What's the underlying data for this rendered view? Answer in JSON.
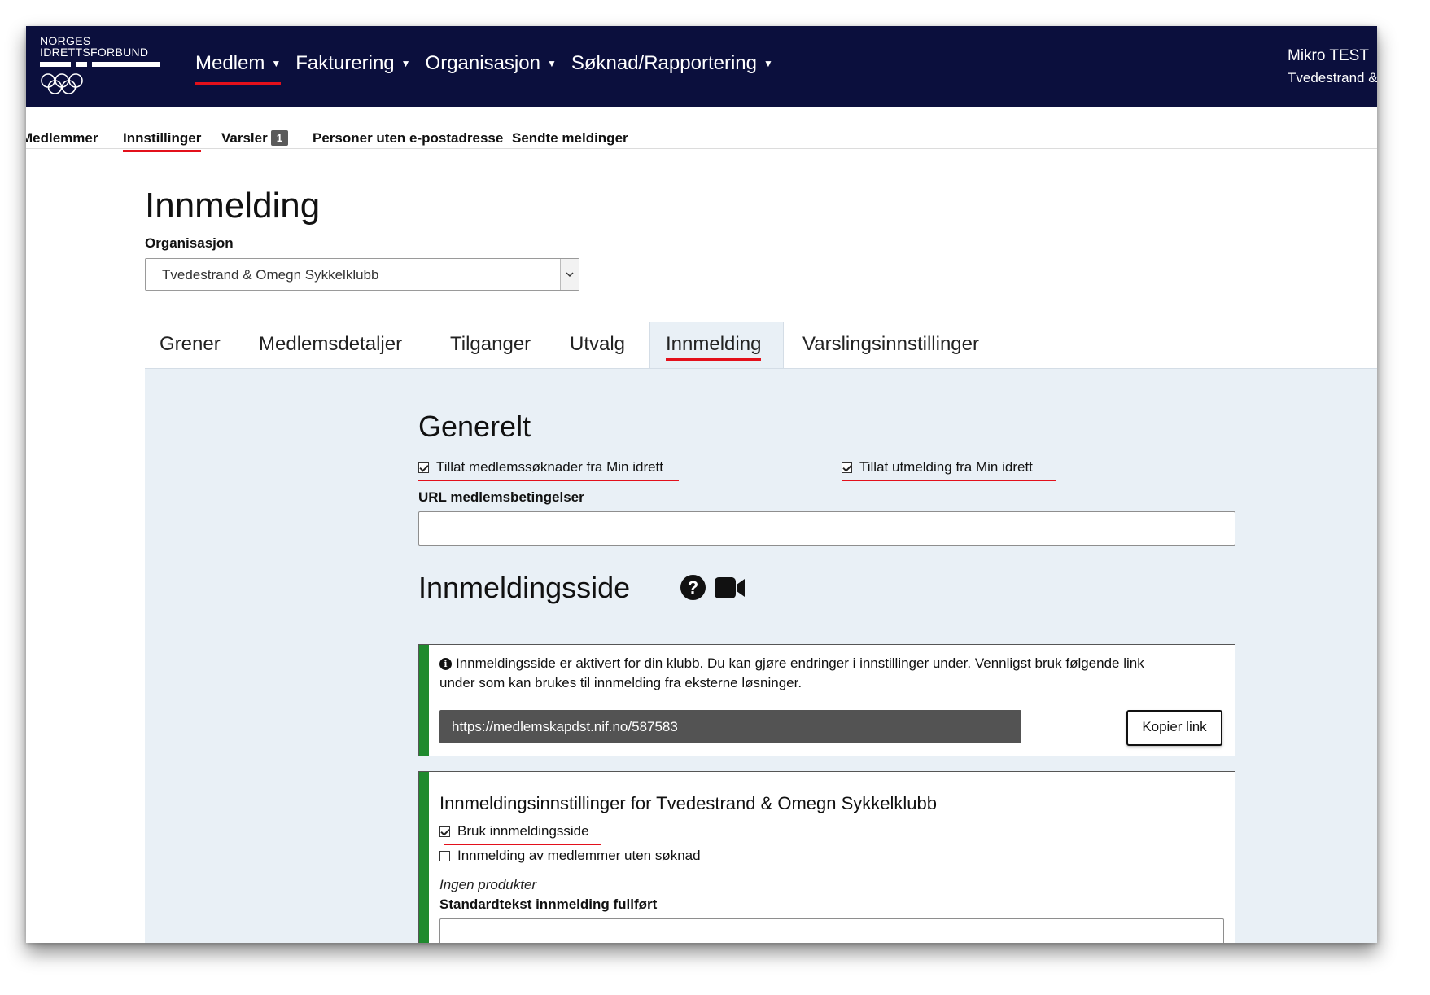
{
  "header": {
    "logo_line1": "NORGES",
    "logo_line2": "IDRETTSFORBUND",
    "nav": [
      {
        "label": "Medlem",
        "active": true
      },
      {
        "label": "Fakturering"
      },
      {
        "label": "Organisasjon"
      },
      {
        "label": "Søknad/Rapportering"
      }
    ],
    "user_name": "Mikro TEST",
    "user_club": "Tvedestrand &"
  },
  "subnav": {
    "items": [
      {
        "label": "Medlemmer"
      },
      {
        "label": "Innstillinger",
        "active": true
      },
      {
        "label": "Varsler",
        "badge": "1"
      },
      {
        "label": "Personer uten e-postadresse"
      },
      {
        "label": "Sendte meldinger"
      }
    ]
  },
  "page": {
    "title": "Innmelding",
    "org_label": "Organisasjon",
    "org_value": "Tvedestrand & Omegn Sykkelklubb"
  },
  "tabs": [
    {
      "label": "Grener"
    },
    {
      "label": "Medlemsdetaljer"
    },
    {
      "label": "Tilganger"
    },
    {
      "label": "Utvalg"
    },
    {
      "label": "Innmelding",
      "active": true
    },
    {
      "label": "Varslingsinnstillinger"
    }
  ],
  "generelt": {
    "title": "Generelt",
    "allow_applications": {
      "label": "Tillat medlemssøknader fra Min idrett",
      "checked": true
    },
    "allow_resign": {
      "label": "Tillat utmelding fra Min idrett",
      "checked": true
    },
    "url_label": "URL medlemsbetingelser",
    "url_value": ""
  },
  "innmeldingsside": {
    "title": "Innmeldingsside",
    "help_icon": "question-circle-icon",
    "video_icon": "video-camera-icon",
    "info_line1": "Innmeldingsside er aktivert for din klubb. Du kan gjøre endringer i innstillinger under. Vennligst bruk følgende link",
    "info_line2": "under som kan brukes til innmelding fra eksterne løsninger.",
    "link_url": "https://medlemskapdst.nif.no/587583",
    "copy_label": "Kopier link"
  },
  "settings": {
    "title": "Innmeldingsinnstillinger for Tvedestrand & Omegn Sykkelklubb",
    "use_page": {
      "label": "Bruk innmeldingsside",
      "checked": true
    },
    "without_application": {
      "label": "Innmelding av medlemmer uten søknad",
      "checked": false
    },
    "no_products": "Ingen produkter",
    "standard_text_label": "Standardtekst innmelding fullført"
  },
  "colors": {
    "navbar": "#0b0f3d",
    "accent_red": "#e3101b",
    "panel_bg": "#e9f0f6",
    "success_stripe": "#1f8a2e"
  }
}
